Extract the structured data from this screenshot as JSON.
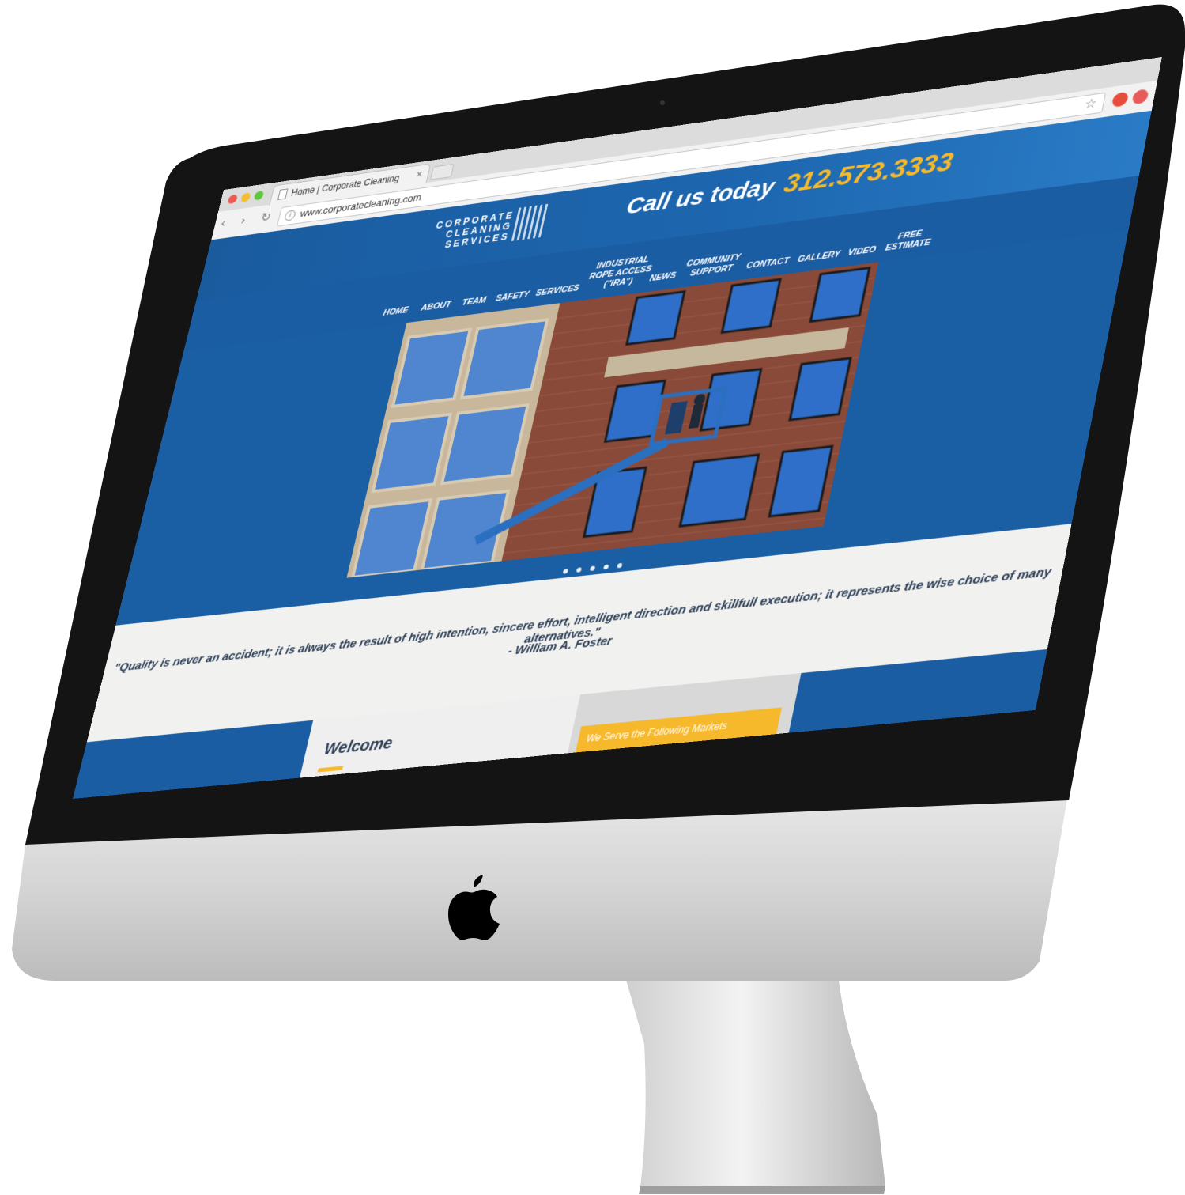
{
  "browser": {
    "tab_title": "Home | Corporate Cleaning",
    "tab_close": "×",
    "url": "www.corporatecleaning.com",
    "nav_buttons": "‹ › ↻"
  },
  "site": {
    "logo_text": "CORPORATE\nCLEANING\nSERVICES",
    "cta_label": "Call us today",
    "cta_phone": "312.573.3333",
    "nav": [
      {
        "label": "HOME"
      },
      {
        "label": "ABOUT"
      },
      {
        "label": "TEAM"
      },
      {
        "label": "SAFETY"
      },
      {
        "label": "SERVICES"
      },
      {
        "label": "INDUSTRIAL\nROPE ACCESS\n(\"IRA\")"
      },
      {
        "label": "NEWS"
      },
      {
        "label": "COMMUNITY\nSUPPORT"
      },
      {
        "label": "CONTACT"
      },
      {
        "label": "GALLERY"
      },
      {
        "label": "VIDEO"
      },
      {
        "label": "FREE\nESTIMATE"
      }
    ],
    "slider_dots": 5,
    "quote": "\"Quality is never an accident; it is always the result of high intention, sincere effort, intelligent direction and skillfull execution; it represents the wise choice of many alternatives.\"",
    "quote_author": "- William A. Foster",
    "welcome_title": "Welcome",
    "markets_button": "We Serve the Following Markets"
  },
  "colors": {
    "brand_blue": "#1b5da2",
    "accent_gold": "#f6b92b",
    "quote_bg": "#f1f1f0",
    "text_dark": "#2c3e55"
  }
}
